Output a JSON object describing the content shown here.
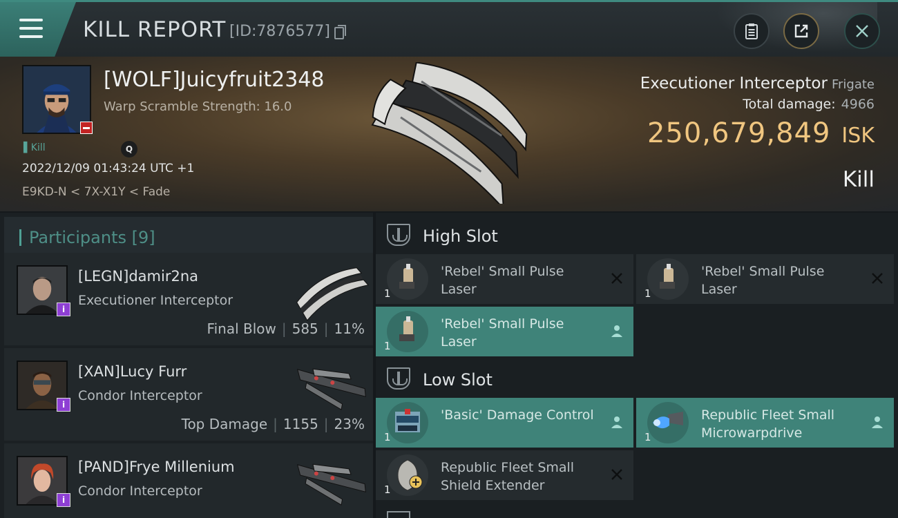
{
  "header": {
    "title": "KILL REPORT",
    "id_label": "[ID:7876577]"
  },
  "victim": {
    "name": "[WOLF]Juicyfruit2348",
    "warp_scramble": "Warp Scramble Strength: 16.0",
    "kill_tag": "Kill",
    "timestamp": "2022/12/09 01:43:24 UTC +1",
    "location": "E9KD-N < 7X-X1Y < Fade",
    "ship_name": "Executioner Interceptor",
    "ship_class": "Frigate",
    "total_damage_label": "Total damage:",
    "total_damage": "4966",
    "isk_value": "250,679,849",
    "isk_unit": "ISK",
    "result": "Kill"
  },
  "participants": {
    "title": "Participants",
    "count": "[9]",
    "items": [
      {
        "name": "[LEGN]damir2na",
        "ship": "Executioner Interceptor",
        "role": "Final Blow",
        "damage": "585",
        "percent": "11%"
      },
      {
        "name": "[XAN]Lucy Furr",
        "ship": "Condor Interceptor",
        "role": "Top Damage",
        "damage": "1155",
        "percent": "23%"
      },
      {
        "name": "[PAND]Frye Millenium",
        "ship": "Condor Interceptor"
      }
    ]
  },
  "fitting": {
    "high_slot": "High Slot",
    "low_slot": "Low Slot",
    "high_modules": [
      {
        "name": "'Rebel' Small Pulse Laser",
        "qty": "1",
        "state": "destroyed"
      },
      {
        "name": "'Rebel' Small Pulse Laser",
        "qty": "1",
        "state": "destroyed"
      },
      {
        "name": "'Rebel' Small Pulse Laser",
        "qty": "1",
        "state": "dropped"
      }
    ],
    "low_modules": [
      {
        "name": "'Basic' Damage Control",
        "qty": "1",
        "state": "dropped"
      },
      {
        "name": "Republic Fleet Small Microwarpdrive",
        "qty": "1",
        "state": "dropped"
      },
      {
        "name": "Republic Fleet Small Shield Extender",
        "qty": "1",
        "state": "destroyed"
      }
    ]
  },
  "colors": {
    "accent": "#3f8379",
    "isk": "#f0c680",
    "corp_badge": "#c22323",
    "participant_badge": "#8e3fd4"
  },
  "icons": {
    "menu": "hamburger-menu-icon",
    "copy": "copy-icon",
    "clipboard": "clipboard-icon",
    "share": "share-icon",
    "close": "close-icon",
    "search": "search-icon",
    "slot": "slot-icon",
    "destroyed": "destroyed-x-icon",
    "dropped": "dropped-person-icon"
  }
}
